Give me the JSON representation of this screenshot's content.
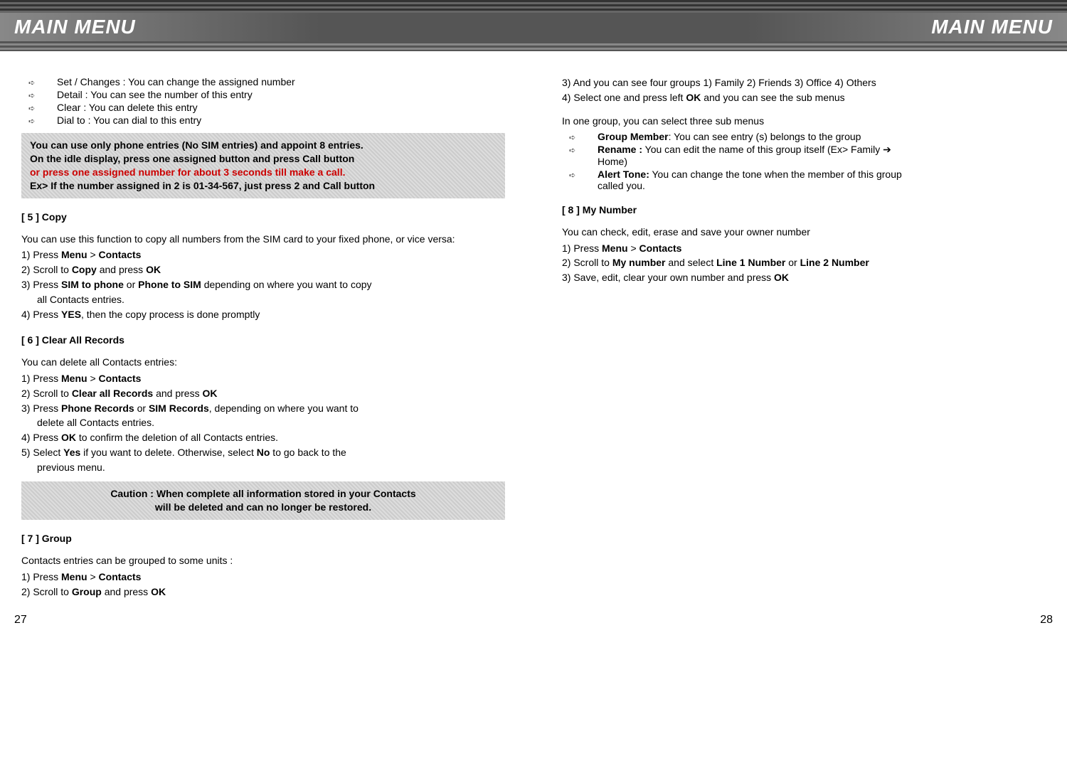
{
  "header": {
    "left_title": "MAIN MENU",
    "right_title": "MAIN MENU"
  },
  "left_col": {
    "top_bullets": [
      "Set / Changes : You can change the assigned number",
      "Detail : You can see the number of this entry",
      "Clear : You can delete this entry",
      "Dial to : You can dial to this entry"
    ],
    "note_box": {
      "line1": "You can use only phone entries (No SIM entries) and appoint 8 entries.",
      "line2": "On the idle display, press one assigned button and press Call  button",
      "line3_red": "or press one assigned number for about 3 seconds till make a call.",
      "line4": "Ex> If the number assigned in 2 is 01-34-567, just press 2 and Call button"
    },
    "sec5": {
      "head": "[ 5 ]  Copy",
      "intro": "You can use this function to copy all numbers from the SIM card to your fixed phone, or vice versa:",
      "s1a": "1)  Press ",
      "s1b": "Menu",
      "s1c": " > ",
      "s1d": "Contacts",
      "s2a": "2)  Scroll to ",
      "s2b": "Copy",
      "s2c": " and press ",
      "s2d": "OK",
      "s3a": "3)  Press ",
      "s3b": "SIM to phone",
      "s3c": " or ",
      "s3d": "Phone to SIM",
      "s3e": " depending on where you want to copy",
      "s3f": "all Contacts entries.",
      "s4a": "4)  Press ",
      "s4b": "YES",
      "s4c": ", then the copy process is done promptly"
    },
    "sec6": {
      "head": "[ 6 ]  Clear All Records",
      "intro": "You can delete all Contacts entries:",
      "s1a": "1)  Press ",
      "s1b": "Menu",
      "s1c": " > ",
      "s1d": "Contacts",
      "s2a": "2)  Scroll to ",
      "s2b": "Clear all Records",
      "s2c": " and press ",
      "s2d": "OK",
      "s3a": "3)  Press ",
      "s3b": "Phone Records",
      "s3c": " or ",
      "s3d": "SIM Records",
      "s3e": ", depending on where you want to",
      "s3f": "delete all Contacts entries.",
      "s4a": "4)  Press ",
      "s4b": "OK",
      "s4c": " to confirm the deletion of all Contacts entries.",
      "s5a": "5)  Select ",
      "s5b": "Yes",
      "s5c": " if you want to delete. Otherwise, select ",
      "s5d": "No",
      "s5e": " to go back to the",
      "s5f": "previous menu."
    },
    "caution": {
      "line1": "Caution : When complete all information stored in your Contacts",
      "line2": "will be deleted and can no longer be restored."
    },
    "sec7": {
      "head": "[ 7 ]  Group",
      "intro": "Contacts entries can be grouped to some units :",
      "s1a": "1)  Press ",
      "s1b": "Menu",
      "s1c": " > ",
      "s1d": "Contacts",
      "s2a": "2)  Scroll to ",
      "s2b": "Group",
      "s2c": " and press ",
      "s2d": "OK"
    }
  },
  "right_col": {
    "top": {
      "l1": "3)  And you can see four groups 1) Family 2) Friends 3) Office 4) Others",
      "l2a": "4)  Select one and press left  ",
      "l2b": "OK",
      "l2c": " and you can see the sub menus",
      "intro": "In one group, you can select three sub menus",
      "b1a": "Group Member",
      "b1b": ": You can see entry (s) belongs to the group",
      "b2a": "Rename :",
      "b2b": " You can edit the name of this group itself (Ex> Family ➔",
      "b2c": "Home)",
      "b3a": "Alert Tone:",
      "b3b": " You can change the tone when the member of this group",
      "b3c": "called you."
    },
    "sec8": {
      "head": "[ 8 ]  My Number",
      "intro": "You can check, edit, erase and save your owner number",
      "s1a": "1)  Press ",
      "s1b": "Menu",
      "s1c": " > ",
      "s1d": "Contacts",
      "s2a": "2)  Scroll to ",
      "s2b": "My number",
      "s2c": " and select ",
      "s2d": "Line 1 Number",
      "s2e": " or ",
      "s2f": "Line 2 Number",
      "s3a": "3)  Save, edit, clear your own number and press ",
      "s3b": "OK"
    }
  },
  "footer": {
    "left_page": "27",
    "right_page": "28"
  }
}
